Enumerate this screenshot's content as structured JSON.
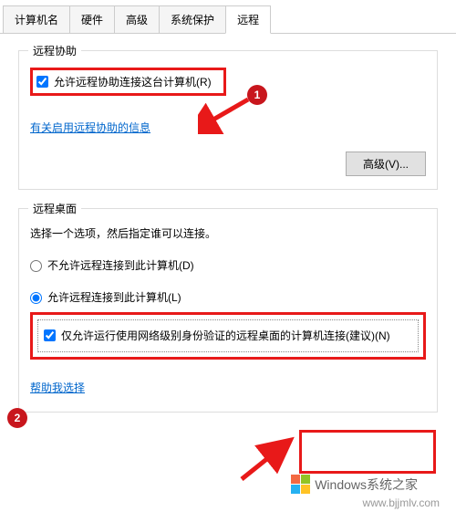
{
  "tabs": {
    "computer_name": "计算机名",
    "hardware": "硬件",
    "advanced": "高级",
    "system_protection": "系统保护",
    "remote": "远程"
  },
  "remote_assist": {
    "legend": "远程协助",
    "allow_label": "允许远程协助连接这台计算机(R)",
    "info_link": "有关启用远程协助的信息",
    "advanced_btn": "高级(V)..."
  },
  "remote_desktop": {
    "legend": "远程桌面",
    "desc": "选择一个选项，然后指定谁可以连接。",
    "deny_label": "不允许远程连接到此计算机(D)",
    "allow_label": "允许远程连接到此计算机(L)",
    "nla_label": "仅允许运行使用网络级别身份验证的远程桌面的计算机连接(建议)(N)",
    "help_link": "帮助我选择"
  },
  "markers": {
    "one": "1",
    "two": "2"
  },
  "watermark": {
    "text": "Windows系统之家",
    "url": "www.bjjmlv.com"
  },
  "annotation_color": "#e81919"
}
